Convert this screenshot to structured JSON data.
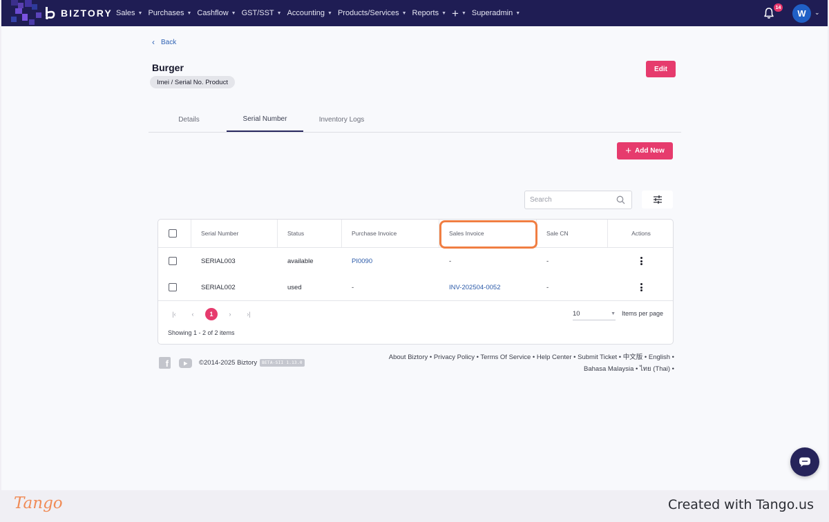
{
  "app": {
    "brand": "BIZTORY",
    "notifications_count": "14",
    "avatar_initial": "W"
  },
  "nav": {
    "items": [
      {
        "label": "Sales"
      },
      {
        "label": "Purchases"
      },
      {
        "label": "Cashflow"
      },
      {
        "label": "GST/SST"
      },
      {
        "label": "Accounting"
      },
      {
        "label": "Products/Services"
      },
      {
        "label": "Reports"
      },
      {
        "label": "+"
      },
      {
        "label": "Superadmin"
      }
    ]
  },
  "page": {
    "back_label": "Back",
    "title": "Burger",
    "product_type": "Imei / Serial No. Product",
    "edit_label": "Edit"
  },
  "tabs": [
    {
      "label": "Details",
      "active": false
    },
    {
      "label": "Serial Number",
      "active": true
    },
    {
      "label": "Inventory Logs",
      "active": false
    }
  ],
  "actions": {
    "add_new_label": "Add New",
    "search_placeholder": "Search"
  },
  "table": {
    "columns": [
      "Serial Number",
      "Status",
      "Purchase Invoice",
      "Sales Invoice",
      "Sale CN",
      "Actions"
    ],
    "rows": [
      {
        "serial": "SERIAL003",
        "status": "available",
        "purchase_invoice": "PI0090",
        "sales_invoice": "-",
        "sale_cn": "-"
      },
      {
        "serial": "SERIAL002",
        "status": "used",
        "purchase_invoice": "-",
        "sales_invoice": "INV-202504-0052",
        "sale_cn": "-"
      }
    ],
    "pagination": {
      "current_page": "1",
      "per_page": "10",
      "per_page_label": "Items per page",
      "showing": "Showing 1 - 2 of 2 items"
    }
  },
  "footer": {
    "copyright": "©2014-2025 Biztory",
    "version": "BETA-SII 1.13.0",
    "links_line1": "About Biztory • Privacy Policy • Terms Of Service • Help Center • Submit Ticket • 中文版 • English •",
    "links_line2": "Bahasa Malaysia • ไทย (Thai) •"
  },
  "tango": {
    "logo": "Tango",
    "credit": "Created with Tango.us"
  },
  "colors": {
    "nav_bg": "#1f1d54",
    "accent_pink": "#e63b6d",
    "link_blue": "#2a59a8",
    "highlight_orange": "#f07e42"
  }
}
